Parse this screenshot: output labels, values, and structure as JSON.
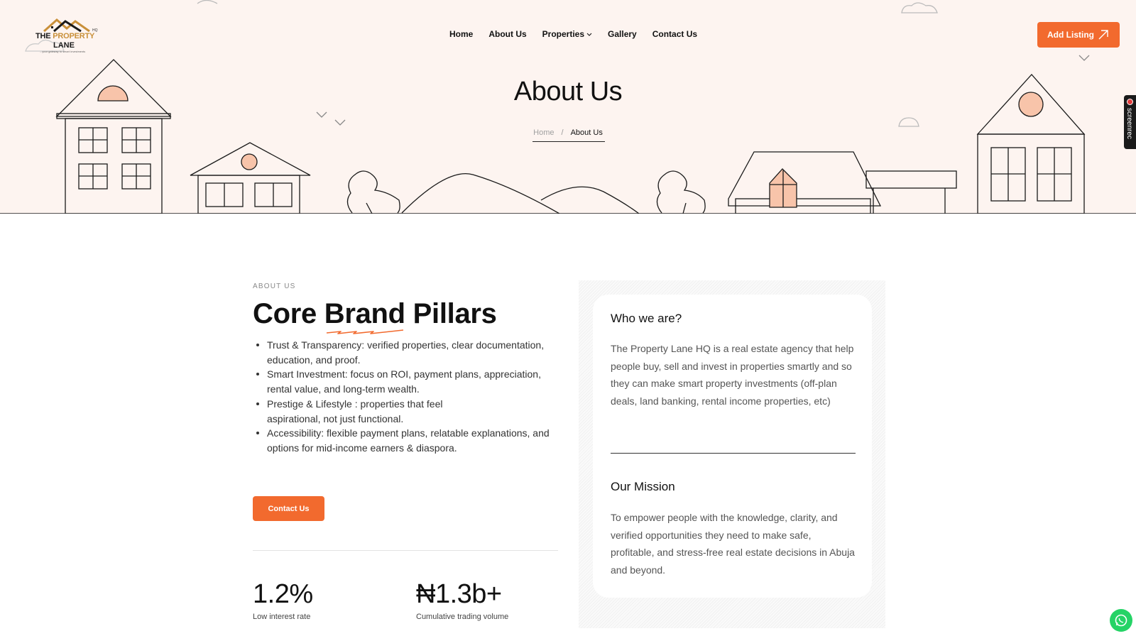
{
  "brand": {
    "line1_a": "THE ",
    "line1_b": "PROPERTY",
    "line2": "LANE",
    "suffix": "HQ",
    "tagline": "...your gateway to smart investments"
  },
  "nav": {
    "items": [
      {
        "label": "Home"
      },
      {
        "label": "About Us"
      },
      {
        "label": "Properties"
      },
      {
        "label": "Gallery"
      },
      {
        "label": "Contact Us"
      }
    ],
    "cta_label": "Add Listing"
  },
  "hero": {
    "title": "About Us",
    "breadcrumb_home": "Home",
    "breadcrumb_sep": "/",
    "breadcrumb_current": "About Us"
  },
  "about": {
    "eyebrow": "ABOUT US",
    "heading": "Core Brand Pillars",
    "pillars": [
      "Trust & Transparency: verified properties, clear documentation, education, and proof.",
      "Smart Investment: focus on ROI, payment plans, appreciation, rental value, and long-term wealth.",
      "Prestige & Lifestyle : properties that feel aspirational, not just functional.",
      "Accessibility: flexible payment plans, relatable explanations, and options for mid-income earners & diaspora."
    ],
    "contact_label": "Contact Us",
    "stats": [
      {
        "value": "1.2%",
        "label": "Low interest rate"
      },
      {
        "value": "₦1.3b+",
        "label": "Cumulative trading volume"
      }
    ]
  },
  "card": {
    "who_title": "Who we are?",
    "who_text": "The Property Lane HQ is a real estate agency that help people buy, sell and invest in properties smartly and so they can make smart property investments (off-plan deals, land banking, rental income properties, etc)",
    "mission_title": "Our Mission",
    "mission_text": "To empower people with the knowledge, clarity, and verified opportunities they need to make safe, profitable, and stress-free real estate decisions in Abuja and beyond."
  },
  "widgets": {
    "screenrec_label": "screenrec"
  },
  "colors": {
    "accent": "#f26a2e",
    "hero_bg": "#fdf4f0",
    "peach": "#f8c4aa"
  }
}
